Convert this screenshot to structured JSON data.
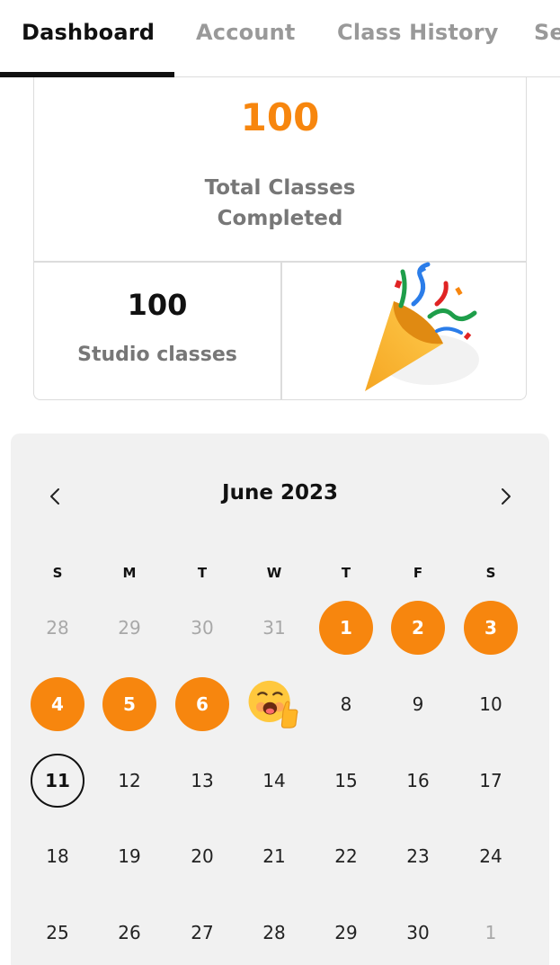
{
  "tabs": [
    {
      "label": "Dashboard",
      "active": true
    },
    {
      "label": "Account",
      "active": false
    },
    {
      "label": "Class History",
      "active": false
    },
    {
      "label": "Se",
      "active": false
    }
  ],
  "stats": {
    "total_classes": "100",
    "total_label_line1": "Total Classes",
    "total_label_line2": "Completed",
    "studio_classes": "100",
    "studio_label": "Studio classes",
    "celebration_icon": "party-popper-icon"
  },
  "calendar": {
    "title": "June 2023",
    "prev_icon": "chevron-left-icon",
    "next_icon": "chevron-right-icon",
    "weekdays": [
      "S",
      "M",
      "T",
      "W",
      "T",
      "F",
      "S"
    ],
    "weeks": [
      [
        {
          "d": "28",
          "s": "muted"
        },
        {
          "d": "29",
          "s": "muted"
        },
        {
          "d": "30",
          "s": "muted"
        },
        {
          "d": "31",
          "s": "muted"
        },
        {
          "d": "1",
          "s": "done"
        },
        {
          "d": "2",
          "s": "done"
        },
        {
          "d": "3",
          "s": "done"
        }
      ],
      [
        {
          "d": "4",
          "s": "done"
        },
        {
          "d": "5",
          "s": "done"
        },
        {
          "d": "6",
          "s": "done"
        },
        {
          "d": "",
          "s": "emoji",
          "icon": "thumbs-up-face-icon"
        },
        {
          "d": "8",
          "s": ""
        },
        {
          "d": "9",
          "s": ""
        },
        {
          "d": "10",
          "s": ""
        }
      ],
      [
        {
          "d": "11",
          "s": "today"
        },
        {
          "d": "12",
          "s": ""
        },
        {
          "d": "13",
          "s": ""
        },
        {
          "d": "14",
          "s": ""
        },
        {
          "d": "15",
          "s": ""
        },
        {
          "d": "16",
          "s": ""
        },
        {
          "d": "17",
          "s": ""
        }
      ],
      [
        {
          "d": "18",
          "s": ""
        },
        {
          "d": "19",
          "s": ""
        },
        {
          "d": "20",
          "s": ""
        },
        {
          "d": "21",
          "s": ""
        },
        {
          "d": "22",
          "s": ""
        },
        {
          "d": "23",
          "s": ""
        },
        {
          "d": "24",
          "s": ""
        }
      ],
      [
        {
          "d": "25",
          "s": ""
        },
        {
          "d": "26",
          "s": ""
        },
        {
          "d": "27",
          "s": ""
        },
        {
          "d": "28",
          "s": ""
        },
        {
          "d": "29",
          "s": ""
        },
        {
          "d": "30",
          "s": ""
        },
        {
          "d": "1",
          "s": "muted"
        }
      ]
    ]
  },
  "colors": {
    "accent": "#f7860e",
    "muted_text": "#a8a8a8",
    "calendar_bg": "#f1f1f1"
  }
}
